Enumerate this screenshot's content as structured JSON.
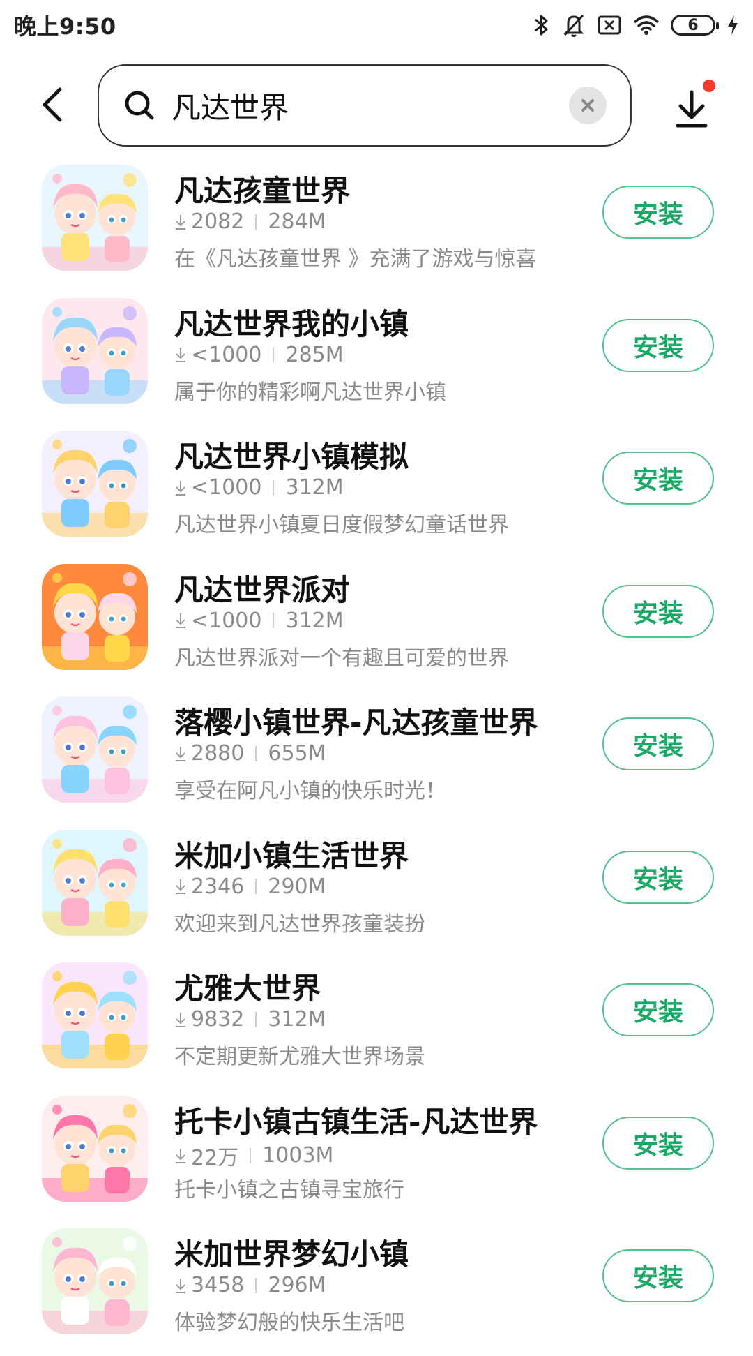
{
  "status_bar": {
    "time": "晚上9:50",
    "battery_level": "6",
    "icons": [
      "bluetooth-icon",
      "mute-icon",
      "no-sim-icon",
      "wifi-icon",
      "battery-icon",
      "charging-icon"
    ]
  },
  "search": {
    "query": "凡达世界",
    "back_icon": "chevron-left-icon",
    "search_icon": "search-icon",
    "clear_icon": "close-icon",
    "download_icon": "download-icon",
    "has_notification": true
  },
  "theme": {
    "accent": "#19a866",
    "accent_border": "#52c08c",
    "notify": "#f23a2f"
  },
  "apps": [
    {
      "name": "凡达孩童世界",
      "downloads": "2082",
      "size": "284M",
      "desc": "在《凡达孩童世界 》充满了游戏与惊喜",
      "install": "安装",
      "icon_colors": [
        "#e9f6ff",
        "#ffb9c9",
        "#ffe27a"
      ]
    },
    {
      "name": "凡达世界我的小镇",
      "downloads": "<1000",
      "size": "285M",
      "desc": "属于你的精彩啊凡达世界小镇",
      "install": "安装",
      "icon_colors": [
        "#fde8ef",
        "#9ad7ff",
        "#c8b6ff"
      ]
    },
    {
      "name": "凡达世界小镇模拟",
      "downloads": "<1000",
      "size": "312M",
      "desc": "凡达世界小镇夏日度假梦幻童话世界",
      "install": "安装",
      "icon_colors": [
        "#f5f0ff",
        "#ffd36b",
        "#7ecbff"
      ]
    },
    {
      "name": "凡达世界派对",
      "downloads": "<1000",
      "size": "312M",
      "desc": "凡达世界派对一个有趣且可爱的世界",
      "install": "安装",
      "icon_colors": [
        "#ff8a3d",
        "#ffd84a",
        "#ffd6e8"
      ]
    },
    {
      "name": "落樱小镇世界-凡达孩童世界",
      "downloads": "2880",
      "size": "655M",
      "desc": "享受在阿凡小镇的快乐时光！",
      "install": "安装",
      "icon_colors": [
        "#eef2ff",
        "#ffc2de",
        "#86d4ff"
      ]
    },
    {
      "name": "米加小镇生活世界",
      "downloads": "2346",
      "size": "290M",
      "desc": "欢迎来到凡达世界孩童装扮",
      "install": "安装",
      "icon_colors": [
        "#dff6ff",
        "#ffe06e",
        "#ffb0c8"
      ]
    },
    {
      "name": "尤雅大世界",
      "downloads": "9832",
      "size": "312M",
      "desc": "不定期更新尤雅大世界场景",
      "install": "安装",
      "icon_colors": [
        "#fbe6ff",
        "#ffd24f",
        "#9fe0ff"
      ]
    },
    {
      "name": "托卡小镇古镇生活-凡达世界",
      "downloads": "22万",
      "size": "1003M",
      "desc": "托卡小镇之古镇寻宝旅行",
      "install": "安装",
      "icon_colors": [
        "#ffeef0",
        "#ff77a8",
        "#ffd36b"
      ]
    },
    {
      "name": "米加世界梦幻小镇",
      "downloads": "3458",
      "size": "296M",
      "desc": "体验梦幻般的快乐生活吧",
      "install": "安装",
      "icon_colors": [
        "#eaf8e6",
        "#ffb6cf",
        "#ffffff"
      ]
    }
  ]
}
